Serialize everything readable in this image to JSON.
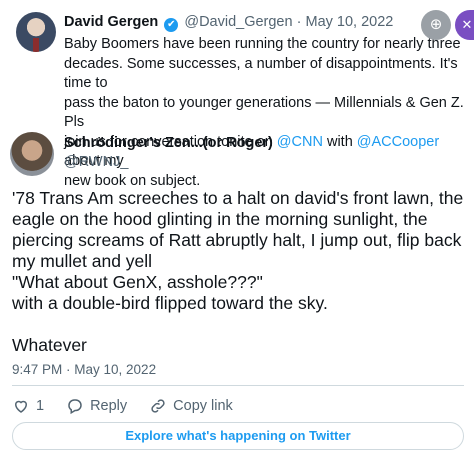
{
  "quoted_tweet": {
    "author_name": "David Gergen",
    "verified_glyph": "✔",
    "handle": "@David_Gergen",
    "separator": "·",
    "date": "May 10, 2022",
    "body_lines": [
      "Baby Boomers have been running the country for nearly three",
      "decades.  Some successes, a number of disappointments.  It's time to",
      "pass the baton to younger generations — Millennials & Gen Z.  Pls",
      "join us for conversation tonite on ",
      "@CNN",
      " with ",
      "@ACCooper",
      " about my",
      "new book on subject."
    ]
  },
  "overlay": {
    "zoom_icon": "zoom-in-icon",
    "zoom_glyph": "⊕",
    "close_icon": "close-icon",
    "close_glyph": "✕"
  },
  "tweet": {
    "author_name": "Schrödinger's Zen...(or Roger)",
    "handle": "@RWNJ_",
    "body_lines": [
      "'78 Trans Am screeches to a halt on david's front lawn, the",
      "eagle on the hood glinting in the morning sunlight, the",
      "piercing screams of Ratt abruptly halt, I jump out, flip back",
      "my mullet and yell",
      "\"What about GenX, asshole???\"",
      "with a double-bird flipped toward the sky."
    ],
    "closing": "Whatever",
    "timestamp": "9:47 PM · May 10, 2022",
    "actions": {
      "like_count": "1",
      "reply_label": "Reply",
      "copy_label": "Copy link"
    },
    "explore_label": "Explore what's happening on Twitter"
  },
  "colors": {
    "link": "#1d9bf0",
    "muted": "#536471",
    "divider": "#cfd9de"
  }
}
